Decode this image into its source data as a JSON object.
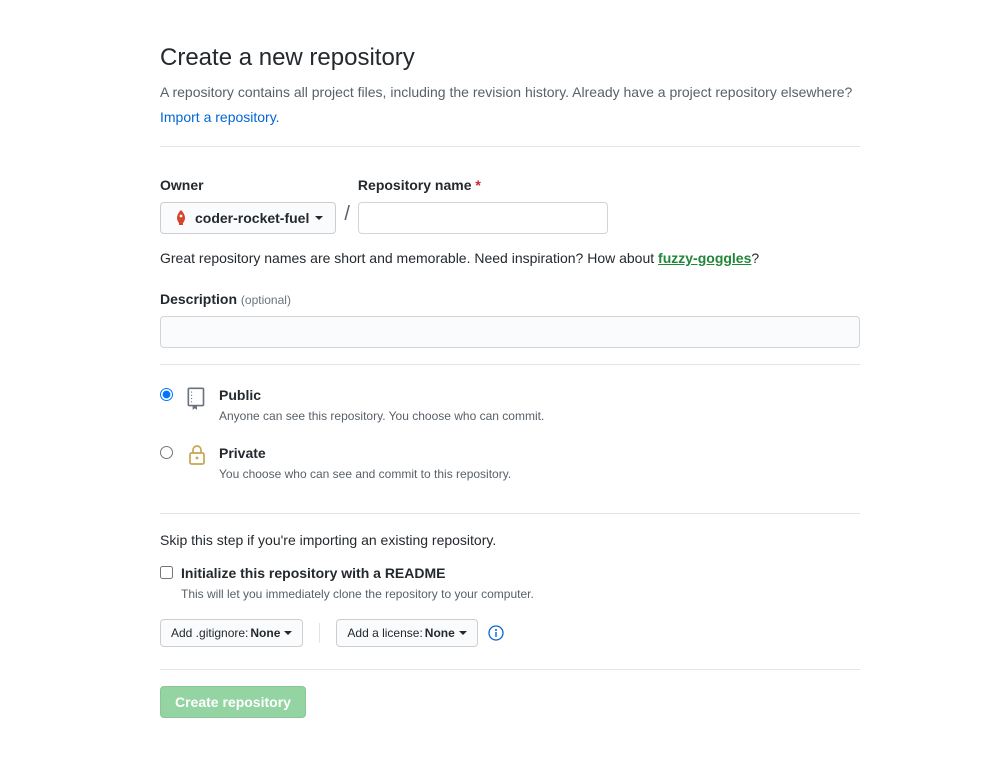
{
  "header": {
    "title": "Create a new repository",
    "subtitle_pre": "A repository contains all project files, including the revision history. Already have a project repository elsewhere? ",
    "import_link": "Import a repository."
  },
  "owner": {
    "label": "Owner",
    "selected": "coder-rocket-fuel"
  },
  "repo_name": {
    "label": "Repository name",
    "required_mark": "*",
    "value": ""
  },
  "hint": {
    "text_pre": "Great repository names are short and memorable. Need inspiration? How about ",
    "suggestion": "fuzzy-goggles",
    "text_post": "?"
  },
  "description": {
    "label": "Description",
    "optional": "(optional)",
    "value": ""
  },
  "visibility": {
    "public": {
      "title": "Public",
      "desc": "Anyone can see this repository. You choose who can commit.",
      "checked": true
    },
    "private": {
      "title": "Private",
      "desc": "You choose who can see and commit to this repository.",
      "checked": false
    }
  },
  "init": {
    "skip_text": "Skip this step if you're importing an existing repository.",
    "readme_label": "Initialize this repository with a README",
    "readme_desc": "This will let you immediately clone the repository to your computer.",
    "readme_checked": false
  },
  "dropdowns": {
    "gitignore_prefix": "Add .gitignore: ",
    "gitignore_value": "None",
    "license_prefix": "Add a license: ",
    "license_value": "None"
  },
  "submit": {
    "label": "Create repository"
  }
}
